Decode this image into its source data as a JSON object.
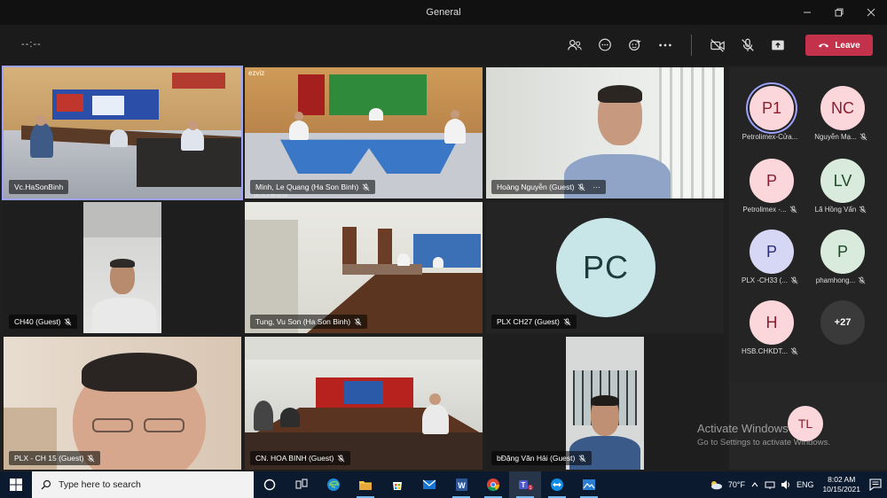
{
  "window": {
    "title": "General",
    "controls": [
      "minimize-icon",
      "maximize-icon",
      "close-icon"
    ]
  },
  "toolbar": {
    "timer": "--:--",
    "leave_label": "Leave",
    "buttons": [
      "people-icon",
      "chat-icon",
      "reactions-icon",
      "more-icon",
      "camera-off-icon",
      "mic-off-icon",
      "share-icon"
    ],
    "leave_color": "#c4314b"
  },
  "tiles": [
    {
      "name": "Vc.HaSonBinh",
      "muted": false,
      "active": true
    },
    {
      "name": "Minh, Le Quang (Ha Son Binh)",
      "muted": true,
      "overlay_brand": "ezviz",
      "overlay_time": "10-15-2  08:01:59"
    },
    {
      "name": "Hoàng Nguyễn (Guest)",
      "muted": true,
      "more": "···"
    },
    {
      "name": "CH40 (Guest)",
      "muted": true
    },
    {
      "name": "Tung, Vu Son (Ha Son Binh)",
      "muted": true
    },
    {
      "name": "PLX CH27 (Guest)",
      "muted": true,
      "initials": "PC"
    },
    {
      "name": "PLX - CH 15 (Guest)",
      "muted": true
    },
    {
      "name": "CN. HOA BINH (Guest)",
      "muted": true
    },
    {
      "name": "bĐặng Văn Hải (Guest)",
      "muted": true
    }
  ],
  "participants": [
    {
      "initials": "P1",
      "label": "Petrolimex-Cửa...",
      "muted": false,
      "color": "pink",
      "speaking": true
    },
    {
      "initials": "NC",
      "label": "Nguyễn Mạ...",
      "muted": true,
      "color": "pink"
    },
    {
      "initials": "P",
      "label": "Petrolimex -...",
      "muted": true,
      "color": "pink"
    },
    {
      "initials": "LV",
      "label": "Lã Hồng Vấn",
      "muted": true,
      "color": "grn"
    },
    {
      "initials": "P",
      "label": "PLX -CH33 (...",
      "muted": true,
      "color": "lav"
    },
    {
      "initials": "P",
      "label": "phamhong...",
      "muted": true,
      "color": "grn"
    },
    {
      "initials": "H",
      "label": "HSB.CHKDT...",
      "muted": true,
      "color": "pink"
    },
    {
      "initials": "+27",
      "label": "",
      "muted": false,
      "color": "more"
    }
  ],
  "self_view": {
    "initials": "TL"
  },
  "watermark": {
    "line1": "Activate Windows",
    "line2": "Go to Settings to activate Windows."
  },
  "taskbar": {
    "search_placeholder": "Type here to search",
    "weather": "70°F",
    "language": "ENG",
    "time": "8:02 AM",
    "date": "10/15/2021",
    "notification_count": "1",
    "apps": [
      "cortana-icon",
      "task-view-icon",
      "edge-icon",
      "file-explorer-icon",
      "store-icon",
      "mail-icon",
      "word-icon",
      "chrome-icon",
      "teams-icon",
      "teamviewer-icon",
      "photo-icon"
    ]
  }
}
